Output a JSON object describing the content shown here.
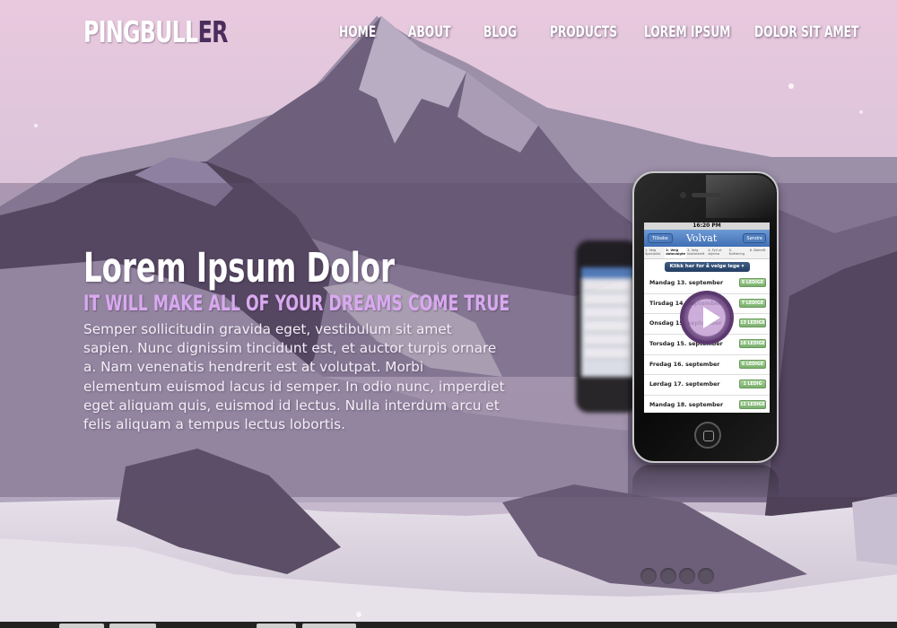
{
  "brand": {
    "name_main": "PINGBULL",
    "name_accent": "ER"
  },
  "nav": {
    "items": [
      {
        "label": "HOME"
      },
      {
        "label": "ABOUT"
      },
      {
        "label": "BLOG"
      },
      {
        "label": "PRODUCTS"
      },
      {
        "label": "LOREM IPSUM"
      },
      {
        "label": "DOLOR SIT AMET"
      }
    ]
  },
  "hero": {
    "title": "Lorem Ipsum Dolor",
    "subtitle": "IT WILL MAKE ALL OF YOUR DREAMS COME TRUE",
    "body": "Semper sollicitudin gravida eget, vestibulum sit amet sapien. Nunc dignissim tincidunt est, et auctor turpis ornare a. Nam venenatis hendrerit est at volutpat. Morbi elementum euismod lacus id semper. In odio nunc, imperdiet eget aliquam quis, euismod id lectus. Nulla interdum arcu et felis aliquam a tempus lectus lobortis."
  },
  "phone_app": {
    "time": "16:20 PM",
    "back_label": "Tilbake",
    "logo": "Volvat",
    "action_label": "Søndre",
    "steps": [
      "1. Velg Spesialist",
      "2. Velg datovalgte",
      "3. Velg klokkeslett",
      "4. Fyll ut skjema",
      "5. Kvittering",
      "6. Bekreft"
    ],
    "cta_label": "Klikk her for å velge lege ▾",
    "days": [
      {
        "day": "Mandag 13. september",
        "badge": "6 LEDIGE"
      },
      {
        "day": "Tirsdag 14. september",
        "badge": "7 LEDIGE"
      },
      {
        "day": "Onsdag 15. september",
        "badge": "13 LEDIGE"
      },
      {
        "day": "Torsdag 15. september",
        "badge": "18 LEDIGE"
      },
      {
        "day": "Fredag 16. september",
        "badge": "6 LEDIGE"
      },
      {
        "day": "Lørdag 17. september",
        "badge": "1 LEDIG"
      },
      {
        "day": "Mandag 18. september",
        "badge": "12 LEDIGE"
      }
    ]
  },
  "icons": {
    "play": "play-icon",
    "home_button": "home-button-icon"
  },
  "slider": {
    "dot_count": 4
  },
  "colors": {
    "accent_purple": "#4a2d5c",
    "subtitle_lilac": "#d9a9ef",
    "band_overlay": "#5f506e",
    "badge_green": "#79b06c",
    "app_blue": "#3f6fb4"
  }
}
